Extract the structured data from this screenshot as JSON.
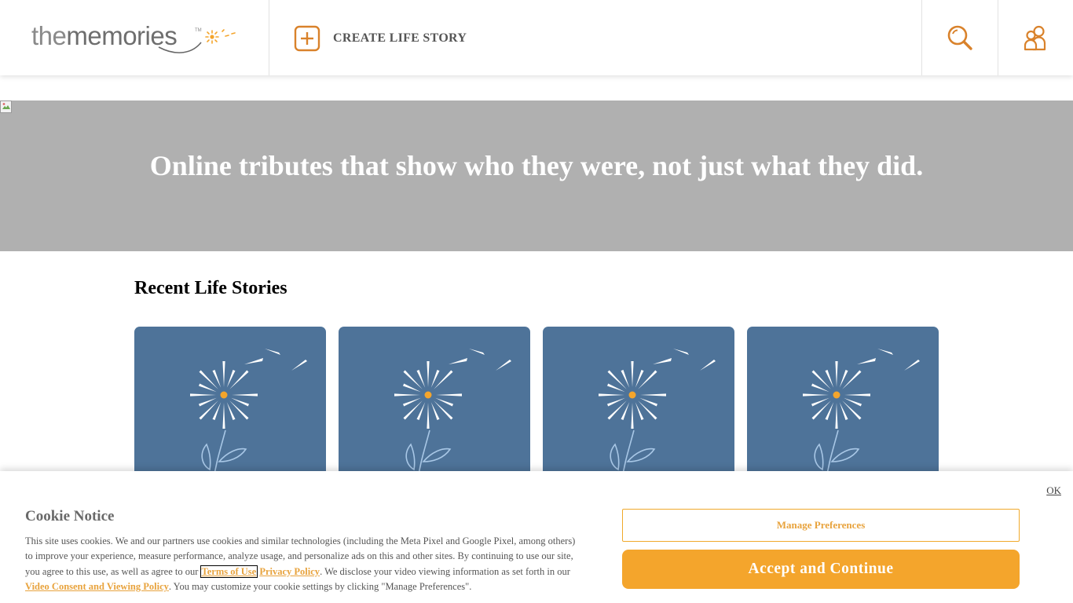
{
  "header": {
    "logo": {
      "text_prefix": "the",
      "text_main": "memories",
      "trademark": "TM"
    },
    "create_label": "CREATE LIFE STORY",
    "icons": [
      "plus-square-icon",
      "search-icon",
      "user-group-icon"
    ]
  },
  "hero": {
    "title": "Online tributes that show who they were, not just what they did."
  },
  "recent": {
    "title": "Recent Life Stories",
    "cards": [
      {
        "image": "dandelion-placeholder"
      },
      {
        "image": "dandelion-placeholder"
      },
      {
        "image": "dandelion-placeholder"
      },
      {
        "image": "dandelion-placeholder"
      }
    ]
  },
  "cookie": {
    "ok": "OK",
    "title": "Cookie Notice",
    "text_1": "This site uses cookies. We and our partners use cookies and similar technologies (including the Meta Pixel and Google Pixel, among others) to improve your experience, measure performance, analyze usage, and personalize ads on this and other sites. By continuing to use our site, you agree to this use, as well as agree to our ",
    "terms_link": "Terms of Use",
    "text_2": " ",
    "privacy_link": "Privacy Policy",
    "text_3": ". We disclose your video viewing information as set forth in our ",
    "video_link": "Video Consent and Viewing Policy",
    "text_4": ". You may customize your cookie settings by clicking \"Manage Preferences\".",
    "manage_label": "Manage Preferences",
    "accept_label": "Accept and Continue"
  },
  "colors": {
    "accent": "#f4a52c",
    "accent_text": "#e8a33d",
    "icon_orange": "#d9822b",
    "card_blue": "#4e7399",
    "hero_gray": "#b0b0b0"
  }
}
